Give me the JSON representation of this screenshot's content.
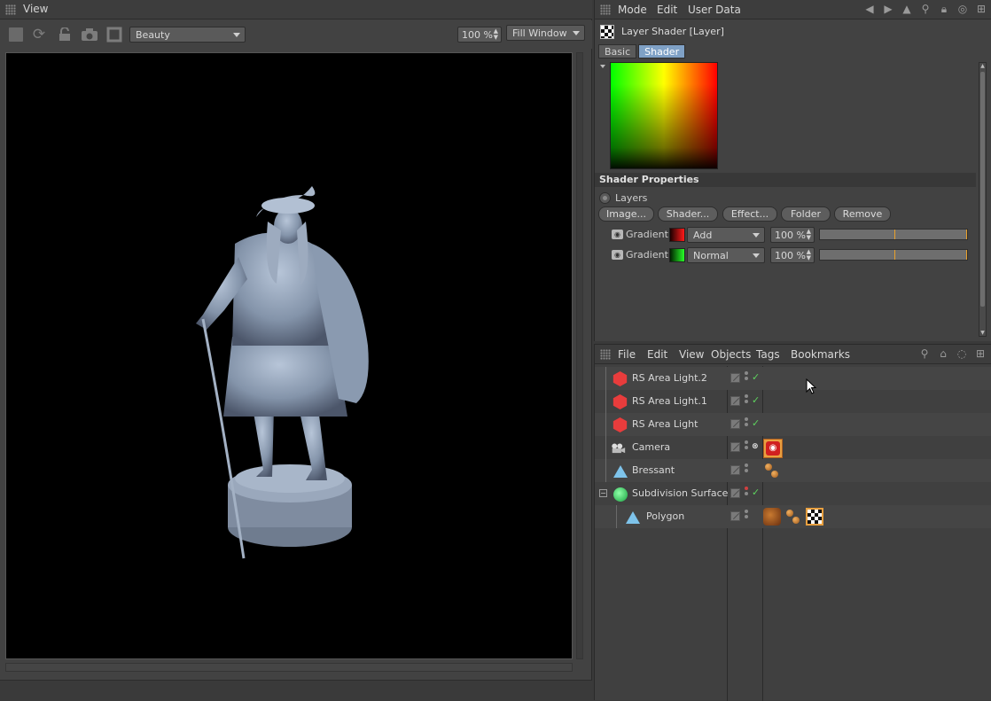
{
  "viewer": {
    "title": "View",
    "toolbar": {
      "channel": "Beauty",
      "zoom": "100 %",
      "fit_mode": "Fill Window"
    }
  },
  "attributes": {
    "menu": [
      "Mode",
      "Edit",
      "User Data"
    ],
    "object_label": "Layer Shader [Layer]",
    "tabs": [
      {
        "label": "Basic",
        "active": false
      },
      {
        "label": "Shader",
        "active": true
      }
    ],
    "section_title": "Shader Properties",
    "layers_label": "Layers",
    "buttons": [
      "Image...",
      "Shader...",
      "Effect...",
      "Folder",
      "Remove"
    ],
    "layers": [
      {
        "name": "Gradient",
        "blend": "Add",
        "percent": "100 %",
        "swatch": "red",
        "opacity_fraction": 1.0
      },
      {
        "name": "Gradient",
        "blend": "Normal",
        "percent": "100 %",
        "swatch": "green",
        "opacity_fraction": 1.0
      }
    ]
  },
  "objects": {
    "menu": [
      "File",
      "Edit",
      "View",
      "Objects",
      "Tags",
      "Bookmarks"
    ],
    "rows": [
      {
        "name": "RS Area Light.2",
        "icon": "area-light-icon"
      },
      {
        "name": "RS Area Light.1",
        "icon": "area-light-icon"
      },
      {
        "name": "RS Area Light",
        "icon": "area-light-icon"
      },
      {
        "name": "Camera",
        "icon": "camera-icon"
      },
      {
        "name": "Bressant",
        "icon": "polygon-object-icon"
      },
      {
        "name": "Subdivision Surface",
        "icon": "subdivision-surface-icon"
      },
      {
        "name": "Polygon",
        "icon": "polygon-object-icon"
      }
    ]
  },
  "colors": {
    "panel_bg": "#424242",
    "active_tab": "#7fa1c6",
    "light_icon": "#e83c3c",
    "check": "#5ed35e"
  }
}
